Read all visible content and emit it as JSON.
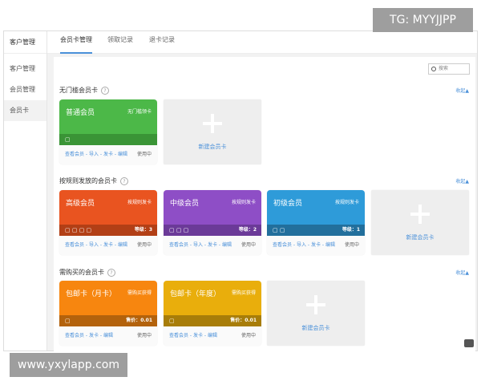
{
  "sidebar": {
    "header": "客户管理",
    "items": [
      {
        "label": "客户管理"
      },
      {
        "label": "会员管理"
      },
      {
        "label": "会员卡",
        "active": true
      }
    ]
  },
  "tabs": [
    {
      "label": "会员卡管理",
      "active": true
    },
    {
      "label": "领取记录"
    },
    {
      "label": "退卡记录"
    }
  ],
  "search": {
    "placeholder": "搜索"
  },
  "collapse_label": "收起▲",
  "new_card_label": "新建会员卡",
  "sections": [
    {
      "title": "无门槛会员卡",
      "cards": [
        {
          "name": "普通会员",
          "type": "无门槛领卡",
          "color": "#4cb848",
          "strip": "#3a9436",
          "icons": 1,
          "level": "",
          "actions": "查看会员 - 导入 - 发卡 - 编辑",
          "status": "使用中"
        }
      ]
    },
    {
      "title": "按规则发放的会员卡",
      "cards": [
        {
          "name": "高级会员",
          "type": "按规则发卡",
          "color": "#e95420",
          "strip": "#b23f16",
          "icons": 4,
          "level": "等级：3",
          "actions": "查看会员 - 导入 - 发卡 - 编辑",
          "status": "使用中"
        },
        {
          "name": "中级会员",
          "type": "按规则发卡",
          "color": "#8e4ec6",
          "strip": "#6b3a98",
          "icons": 3,
          "level": "等级：2",
          "actions": "查看会员 - 导入 - 发卡 - 编辑",
          "status": "使用中"
        },
        {
          "name": "初级会员",
          "type": "按规则发卡",
          "color": "#2e9bd9",
          "strip": "#226f9c",
          "icons": 2,
          "level": "等级：1",
          "actions": "查看会员 - 导入 - 发卡 - 编辑",
          "status": "使用中"
        }
      ]
    },
    {
      "title": "需购买的会员卡",
      "cards": [
        {
          "name": "包邮卡（月卡）",
          "type": "需购买获得",
          "color": "#f7860f",
          "strip": "#b3620c",
          "icons": 1,
          "level": "售价：0.01",
          "actions": "查看会员 - 发卡 - 编辑",
          "status": "使用中"
        },
        {
          "name": "包邮卡（年度）",
          "type": "需购买获得",
          "color": "#e9ae0c",
          "strip": "#a87d09",
          "icons": 1,
          "level": "售价：0.01",
          "actions": "查看会员 - 发卡 - 编辑",
          "status": "使用中"
        }
      ]
    }
  ],
  "watermarks": {
    "top": "TG: MYYJJPP",
    "bottom": "www.yxylapp.com"
  }
}
